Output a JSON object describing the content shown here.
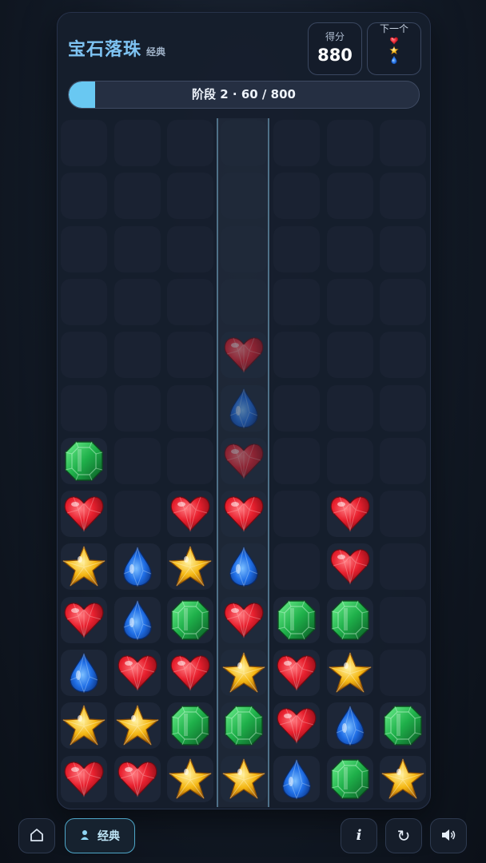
{
  "header": {
    "title": "宝石落珠",
    "mode_tag": "经典"
  },
  "score": {
    "label": "得分",
    "value": "880"
  },
  "next": {
    "label": "下一个",
    "gems": [
      "heart",
      "star",
      "drop"
    ]
  },
  "progress": {
    "text": "阶段 2 · 60 / 800",
    "fraction": 0.075
  },
  "board": {
    "columns": 7,
    "rows": 13,
    "active_column": 3,
    "grid": [
      [
        null,
        null,
        null,
        null,
        null,
        null,
        null
      ],
      [
        null,
        null,
        null,
        null,
        null,
        null,
        null
      ],
      [
        null,
        null,
        null,
        null,
        null,
        null,
        null
      ],
      [
        null,
        null,
        null,
        null,
        null,
        null,
        null
      ],
      [
        null,
        null,
        null,
        "heart-ghost",
        null,
        null,
        null
      ],
      [
        null,
        null,
        null,
        "drop-ghost",
        null,
        null,
        null
      ],
      [
        "emerald",
        null,
        null,
        "heart-ghost",
        null,
        null,
        null
      ],
      [
        "heart",
        null,
        "heart",
        "heart",
        null,
        "heart",
        null
      ],
      [
        "star",
        "drop",
        "star",
        "drop",
        null,
        "heart",
        null
      ],
      [
        "heart",
        "drop",
        "emerald",
        "heart",
        "emerald",
        "emerald",
        null
      ],
      [
        "drop",
        "heart",
        "heart",
        "star",
        "heart",
        "star",
        null
      ],
      [
        "star",
        "star",
        "emerald",
        "emerald",
        "heart",
        "drop",
        "emerald"
      ],
      [
        "heart",
        "heart",
        "star",
        "star",
        "drop",
        "emerald",
        "star"
      ]
    ]
  },
  "footer": {
    "home_icon": "home-icon",
    "mode_label": "经典",
    "mode_icon": "person-icon",
    "info_icon": "info-icon",
    "restart_icon": "restart-icon",
    "sound_icon": "speaker-icon"
  },
  "colors": {
    "accent": "#69c8f2",
    "heart": "#e8202e",
    "drop": "#1f6ee6",
    "emerald": "#1fb04a",
    "star": "#f5b814"
  }
}
